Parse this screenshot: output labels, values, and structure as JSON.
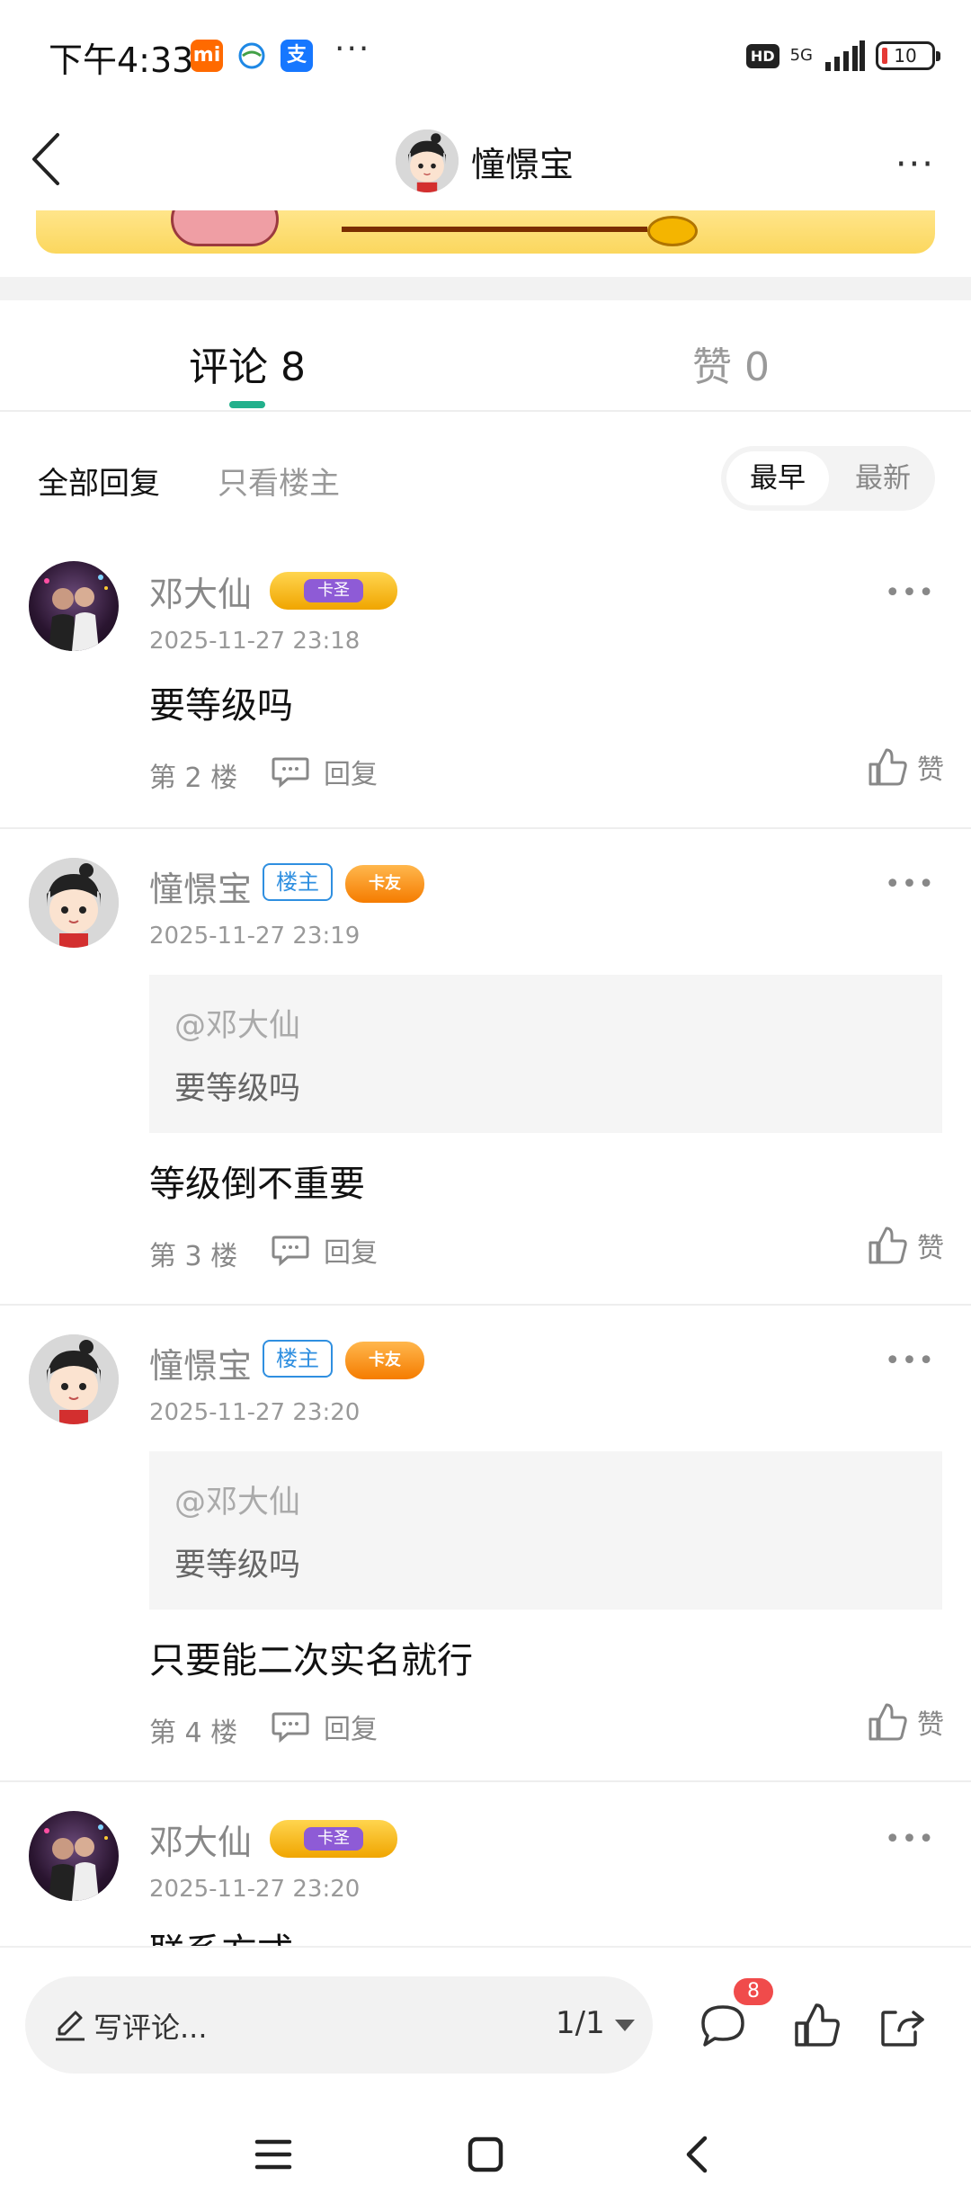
{
  "status_bar": {
    "time": "下午4:33",
    "app_icons": [
      "mi",
      "支"
    ],
    "more": "···",
    "hd": "HD",
    "network": "5G",
    "battery": "10"
  },
  "header": {
    "title": "憧憬宝",
    "more": "···"
  },
  "tabs": {
    "comments": "评论 8",
    "likes": "赞 0"
  },
  "filter": {
    "all": "全部回复",
    "owner_only": "只看楼主",
    "sort": {
      "earliest": "最早",
      "latest": "最新"
    }
  },
  "comments": [
    {
      "name": "邓大仙",
      "badge": "卡圣",
      "date": "2025-11-27 23:18",
      "text": "要等级吗",
      "floor": "第 2 楼",
      "reply": "回复",
      "like": "赞"
    },
    {
      "name": "憧憬宝",
      "owner_tag": "楼主",
      "badge": "卡友",
      "date": "2025-11-27 23:19",
      "quote_user": "@邓大仙",
      "quote_text": "要等级吗",
      "text": "等级倒不重要",
      "floor": "第 3 楼",
      "reply": "回复",
      "like": "赞"
    },
    {
      "name": "憧憬宝",
      "owner_tag": "楼主",
      "badge": "卡友",
      "date": "2025-11-27 23:20",
      "quote_user": "@邓大仙",
      "quote_text": "要等级吗",
      "text": "只要能二次实名就行",
      "floor": "第 4 楼",
      "reply": "回复",
      "like": "赞"
    },
    {
      "name": "邓大仙",
      "badge": "卡圣",
      "date": "2025-11-27 23:20",
      "text": "联系方式"
    }
  ],
  "bottom_bar": {
    "placeholder": "写评论...",
    "page": "1/1",
    "comment_count": "8"
  },
  "colors": {
    "accent": "#22b08c",
    "owner_tag": "#2f8fe0",
    "badge_red": "#f04b4b"
  }
}
